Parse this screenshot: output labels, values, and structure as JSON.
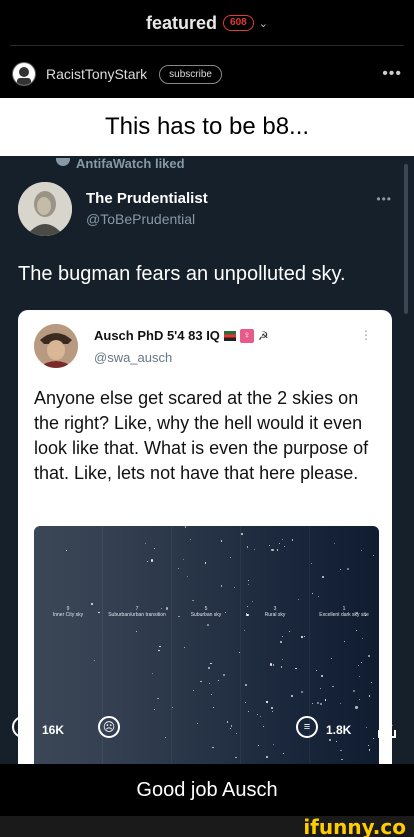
{
  "header": {
    "title": "featured",
    "badge": "608"
  },
  "post_meta": {
    "username": "RacistTonyStark",
    "subscribe_label": "subscribe",
    "more": "•••"
  },
  "meme": {
    "top_caption": "This has to be b8...",
    "retweet_by": "AntifaWatch liked",
    "tweet": {
      "name": "The Prudentialist",
      "handle": "@ToBePrudential",
      "more": "•••",
      "text": "The bugman fears an unpolluted sky."
    },
    "quote": {
      "name": "Ausch PhD 5'4 83 IQ",
      "handle": "@swa_ausch",
      "text": "Anyone else get scared at the 2 skies on the right? Like, why the hell would it even look like that. What is even the purpose of that. Like, lets not have that here please.",
      "sky_labels": [
        {
          "num": "9",
          "text": "Inner City sky"
        },
        {
          "num": "7",
          "text": "Suburban/urban transition"
        },
        {
          "num": "5",
          "text": "Suburban sky"
        },
        {
          "num": "3",
          "text": "Rural sky"
        },
        {
          "num": "1",
          "text": "Excellent dark sky site"
        }
      ]
    }
  },
  "reactions": {
    "smile_count": "16K",
    "comment_count": "1.8K"
  },
  "bottom_caption": "Good job Ausch",
  "watermark": "ifunny.co"
}
